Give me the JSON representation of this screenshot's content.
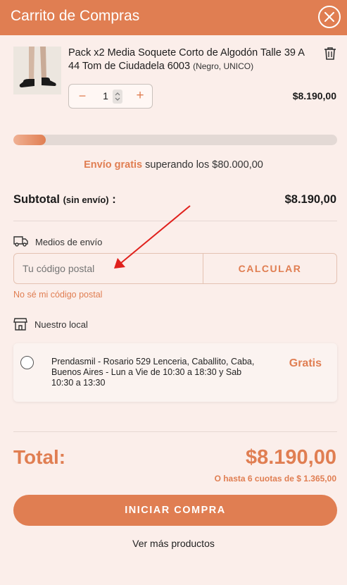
{
  "header": {
    "title": "Carrito de Compras"
  },
  "item": {
    "name": "Pack x2 Media Soquete Corto de Algodón Talle 39 A 44 Tom de Ciudadela 6003",
    "variant": "(Negro, UNICO)",
    "quantity": "1",
    "price": "$8.190,00"
  },
  "shipping_progress": {
    "fraction": 0.1
  },
  "free_shipping": {
    "highlight": "Envío gratis",
    "rest": " superando los $80.000,00"
  },
  "subtotal": {
    "label": "Subtotal",
    "note": "(sin envío)",
    "colon": " :",
    "value": "$8.190,00"
  },
  "shipping": {
    "label": "Medios de envío",
    "zip_placeholder": "Tu código postal",
    "calc_label": "CALCULAR",
    "no_zip_link": "No sé mi código postal"
  },
  "store": {
    "label": "Nuestro local",
    "address": "Prendasmil - Rosario 529 Lenceria, Caballito, Caba, Buenos Aires - Lun a Vie de 10:30 a 18:30 y Sab 10:30 a 13:30",
    "price": "Gratis"
  },
  "total": {
    "label": "Total:",
    "value": "$8.190,00",
    "installments": "O hasta 6 cuotas de $ 1.365,00"
  },
  "actions": {
    "checkout": "INICIAR COMPRA",
    "more": "Ver más productos"
  },
  "colors": {
    "accent": "#e07e52",
    "background": "#fbeeea"
  },
  "icons": [
    "close-icon",
    "trash-icon",
    "truck-icon",
    "store-icon",
    "radio-icon"
  ]
}
